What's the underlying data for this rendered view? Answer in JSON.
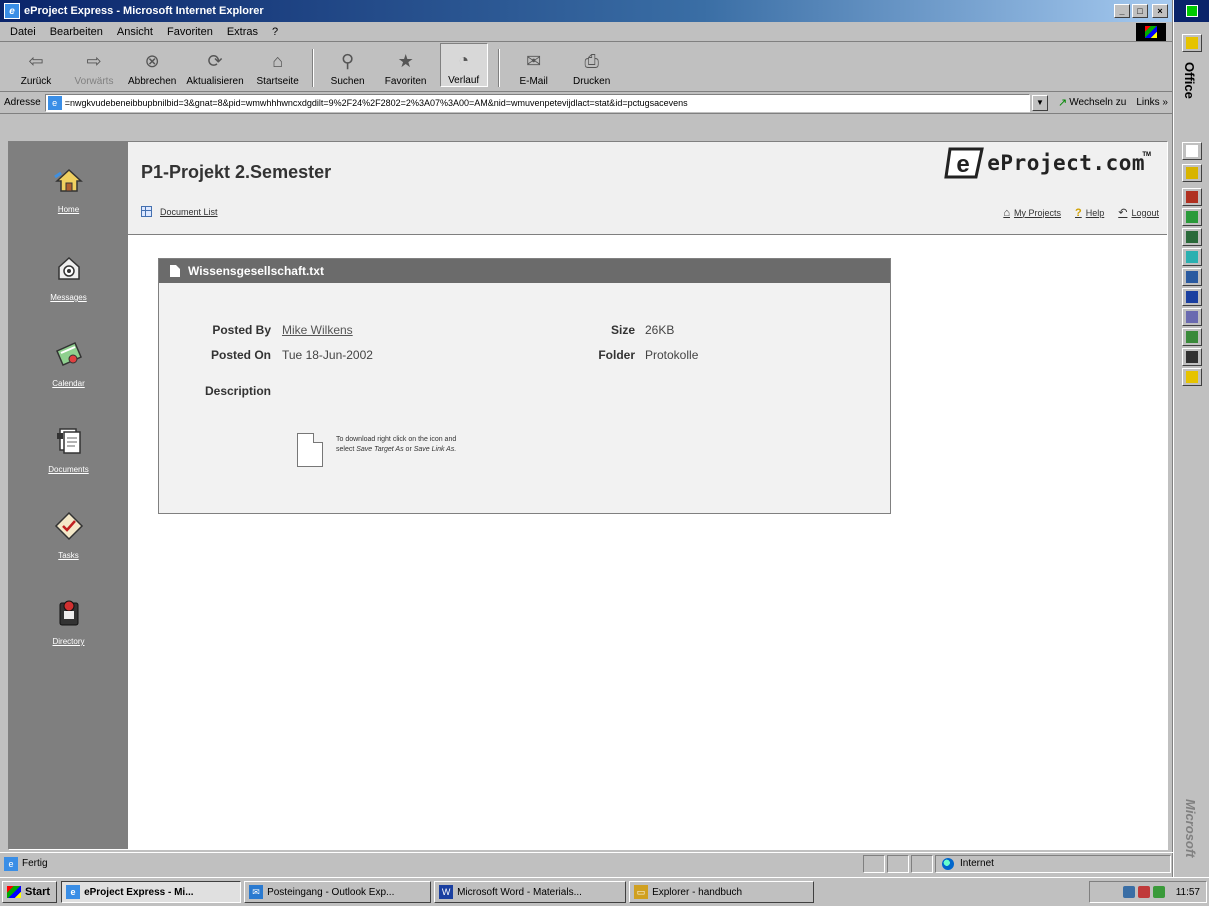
{
  "window": {
    "title": "eProject Express - Microsoft Internet Explorer",
    "controls": {
      "minimize": "_",
      "maximize": "□",
      "close": "×"
    }
  },
  "menubar": {
    "items": [
      {
        "label": "Datei"
      },
      {
        "label": "Bearbeiten"
      },
      {
        "label": "Ansicht"
      },
      {
        "label": "Favoriten"
      },
      {
        "label": "Extras"
      },
      {
        "label": "?"
      }
    ]
  },
  "toolbar": {
    "buttons": [
      {
        "label": "Zurück",
        "icon": "back-arrow-icon",
        "glyph": "⇦"
      },
      {
        "label": "Vorwärts",
        "icon": "forward-arrow-icon",
        "glyph": "⇨"
      },
      {
        "label": "Abbrechen",
        "icon": "stop-icon",
        "glyph": "⊗"
      },
      {
        "label": "Aktualisieren",
        "icon": "refresh-icon",
        "glyph": "⟳"
      },
      {
        "label": "Startseite",
        "icon": "home-icon",
        "glyph": "⌂"
      },
      {
        "label": "Suchen",
        "icon": "search-icon",
        "glyph": "⚲"
      },
      {
        "label": "Favoriten",
        "icon": "favorites-icon",
        "glyph": "★"
      },
      {
        "label": "Verlauf",
        "icon": "history-icon",
        "glyph": "◔"
      },
      {
        "label": "E-Mail",
        "icon": "mail-icon",
        "glyph": "✉"
      },
      {
        "label": "Drucken",
        "icon": "print-icon",
        "glyph": "⎙"
      }
    ]
  },
  "addressbar": {
    "label": "Adresse",
    "url": "=nwgkvudebeneibbupbnilbid=3&gnat=8&pid=wmwhhhwncxdgdilt=9%2F24%2F2802=2%3A07%3A00=AM&nid=wmuvenpetevijdlact=stat&id=pctugsacevens",
    "go_label": "Wechseln zu",
    "links_label": "Links »"
  },
  "leftnav": {
    "items": [
      {
        "label": "Home",
        "icon": "home-icon"
      },
      {
        "label": "Messages",
        "icon": "messages-icon"
      },
      {
        "label": "Calendar",
        "icon": "calendar-icon"
      },
      {
        "label": "Documents",
        "icon": "documents-icon"
      },
      {
        "label": "Tasks",
        "icon": "tasks-icon"
      },
      {
        "label": "Directory",
        "icon": "directory-icon"
      }
    ]
  },
  "header": {
    "project_title": "P1-Projekt 2.Semester",
    "document_list_link": "Document List",
    "logo_text": "eProject.com",
    "logo_tm": "TM",
    "links": [
      {
        "label": "My Projects",
        "icon": "projects-icon"
      },
      {
        "label": "Help",
        "icon": "help-icon"
      },
      {
        "label": "Logout",
        "icon": "logout-icon"
      }
    ]
  },
  "document": {
    "filename": "Wissensgesellschaft.txt",
    "posted_by_label": "Posted By",
    "posted_by": "Mike Wilkens",
    "posted_on_label": "Posted On",
    "posted_on": "Tue 18-Jun-2002",
    "size_label": "Size",
    "size": "26KB",
    "folder_label": "Folder",
    "folder": "Protokolle",
    "description_label": "Description",
    "download_hint_1": "To download right click on the icon and",
    "download_hint_2": "select",
    "download_hint_save_target": "Save Target As",
    "download_hint_or": "or",
    "download_hint_save_link": "Save Link As."
  },
  "statusbar": {
    "status_text": "Fertig",
    "zone_text": "Internet"
  },
  "taskbar": {
    "start_label": "Start",
    "tasks": [
      {
        "label": "eProject Express - Mi...",
        "active": true,
        "color": "#3a8ee6"
      },
      {
        "label": "Posteingang - Outlook Exp...",
        "active": false,
        "color": "#2a7ad0"
      },
      {
        "label": "Microsoft Word - Materials...",
        "active": false,
        "color": "#1a3fa0"
      },
      {
        "label": "Explorer - handbuch",
        "active": false,
        "color": "#d0a020"
      }
    ],
    "clock": "11:57"
  },
  "office_bar": {
    "label": "Office",
    "brand": "Microsoft",
    "button_colors": [
      "#e6c300",
      "#ffffff",
      "#d8b400",
      "#b03020",
      "#2a9a3a",
      "#2a6a3a",
      "#2ab0b0",
      "#2a5aa0",
      "#1a3fa0",
      "#6a6ab0",
      "#3a8a3a",
      "#303030"
    ]
  },
  "colors": {
    "sidebar": "#7f7f7f",
    "panel_header": "#6b6b6b",
    "panel_body": "#f2f2f2",
    "title_bar": "#0a246a"
  }
}
